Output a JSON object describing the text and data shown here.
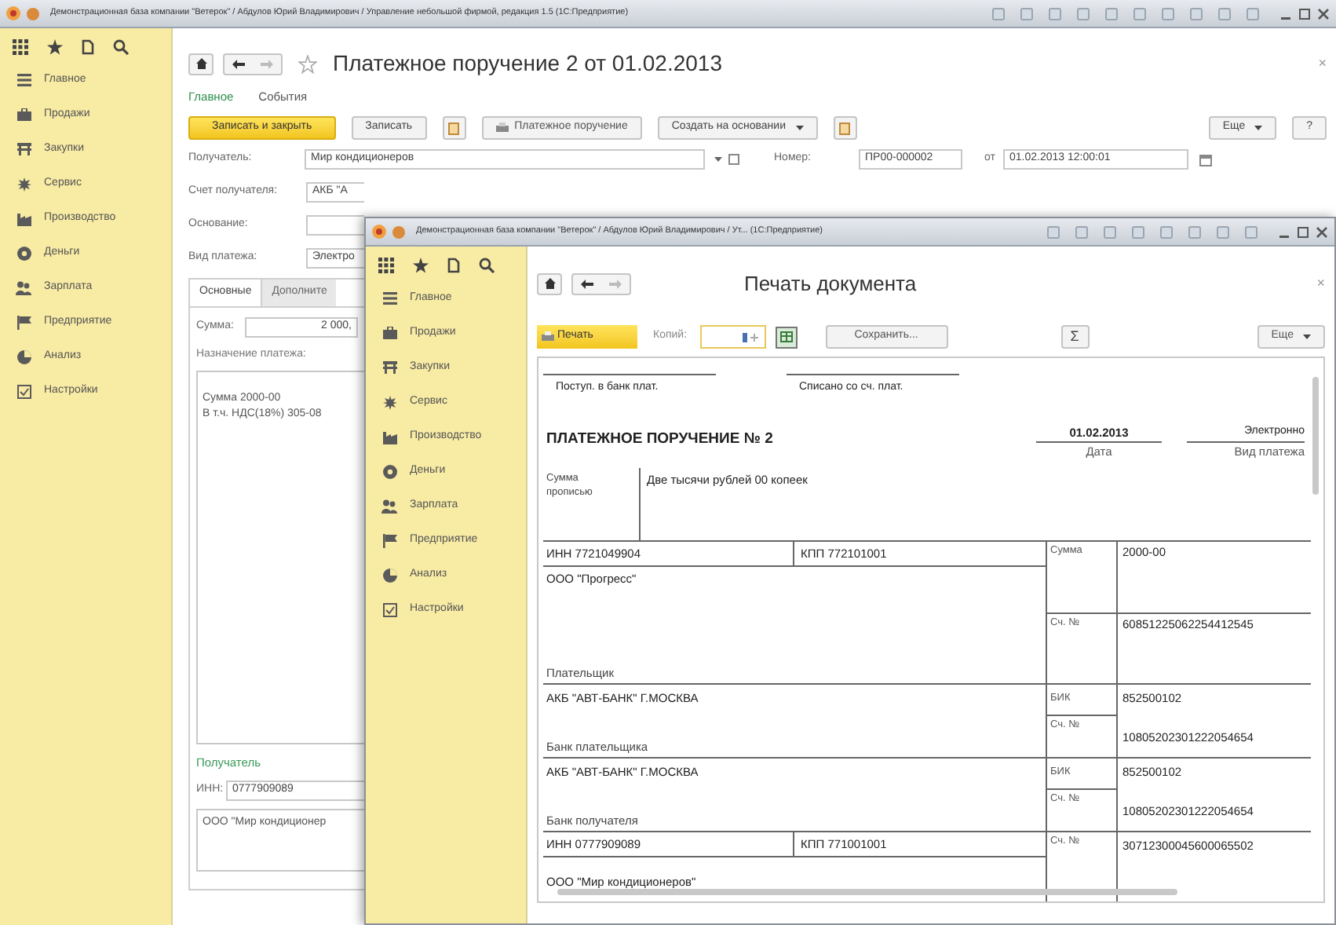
{
  "outer_window": {
    "title": "Демонстрационная база компании \"Ветерок\" / Абдулов Юрий Владимирович / Управление небольшой фирмой, редакция 1.5 (1С:Предприятие)"
  },
  "outer_sidebar": {
    "items": [
      {
        "label": "Главное",
        "kind": "menu"
      },
      {
        "label": "Продажи",
        "kind": "briefcase"
      },
      {
        "label": "Закупки",
        "kind": "shelf"
      },
      {
        "label": "Сервис",
        "kind": "gear"
      },
      {
        "label": "Производство",
        "kind": "factory"
      },
      {
        "label": "Деньги",
        "kind": "coin"
      },
      {
        "label": "Зарплата",
        "kind": "people"
      },
      {
        "label": "Предприятие",
        "kind": "flag"
      },
      {
        "label": "Анализ",
        "kind": "pie"
      },
      {
        "label": "Настройки",
        "kind": "panel"
      }
    ]
  },
  "outer_form": {
    "title": "Платежное поручение 2 от 01.02.2013",
    "close": "×",
    "tabs": [
      {
        "label": "Главное",
        "selected": true
      },
      {
        "label": "События",
        "selected": false
      }
    ],
    "toolbar": [
      {
        "kind": "primary",
        "label": "Записать и закрыть"
      },
      {
        "kind": "plain",
        "label": "Записать"
      },
      {
        "kind": "icon"
      },
      {
        "kind": "print",
        "label": "Платежное поручение"
      },
      {
        "kind": "dropdown",
        "label": "Создать на основании"
      },
      {
        "kind": "icon"
      }
    ],
    "toolbar_right": [
      {
        "kind": "dropdown",
        "label": "Еще"
      },
      {
        "kind": "plain",
        "label": "?"
      }
    ],
    "recipient": {
      "label": "Получатель:",
      "value": "Мир кондиционеров"
    },
    "number": {
      "label": "Номер:",
      "value": "ПР00-000002"
    },
    "date": {
      "label": "от",
      "value": "01.02.2013 12:00:01"
    },
    "fields": [
      {
        "label": "Счет получателя:",
        "value": "АКБ \"А"
      },
      {
        "label": "Основание:"
      },
      {
        "label": "Вид платежа:",
        "value": "Электро"
      }
    ],
    "inner_tabs": [
      {
        "label": "Основные",
        "selected": true
      },
      {
        "label": "Дополните",
        "selected": false
      }
    ],
    "amount": {
      "label": "Сумма:",
      "value": "2 000,"
    },
    "purpose": {
      "label": "Назначение платежа:",
      "lines": [
        "Сумма 2000-00",
        "В т.ч. НДС(18%) 305-08"
      ]
    },
    "recipient_section": "Получатель",
    "inn": {
      "label": "ИНН:",
      "value": "0777909089"
    },
    "recipient_name": "ООО \"Мир кондиционер"
  },
  "print_window": {
    "title": "Демонстрационная база компании \"Ветерок\" / Абдулов Юрий Владимирович / Ут...  (1С:Предприятие)",
    "sidebar": {
      "items": [
        {
          "label": "Главное",
          "kind": "menu"
        },
        {
          "label": "Продажи",
          "kind": "briefcase"
        },
        {
          "label": "Закупки",
          "kind": "shelf"
        },
        {
          "label": "Сервис",
          "kind": "gear"
        },
        {
          "label": "Производство",
          "kind": "factory"
        },
        {
          "label": "Деньги",
          "kind": "coin"
        },
        {
          "label": "Зарплата",
          "kind": "people"
        },
        {
          "label": "Предприятие",
          "kind": "flag"
        },
        {
          "label": "Анализ",
          "kind": "pie"
        },
        {
          "label": "Настройки",
          "kind": "panel"
        }
      ]
    },
    "heading": "Печать документа",
    "close": "×",
    "print_button": "Печать",
    "copies_label": "Копий:",
    "save_button": "Сохранить...",
    "sum_button": "Σ",
    "more_button": "Еще"
  },
  "document": {
    "receipt_labels": [
      "Поступ. в банк плат.",
      "Списано со сч. плат."
    ],
    "title": "ПЛАТЕЖНОЕ ПОРУЧЕНИЕ № 2",
    "date": {
      "value": "01.02.2013",
      "caption": "Дата"
    },
    "payment_type": {
      "value": "Электронно",
      "caption": "Вид платежа"
    },
    "amount_words": {
      "label": "Сумма прописью",
      "value": "Две тысячи рублей 00 копеек"
    },
    "payer": {
      "inn": "ИНН 7721049904",
      "kpp": "КПП 772101001",
      "name": "ООО \"Прогресс\"",
      "caption": "Плательщик",
      "amount_label": "Сумма",
      "amount": "2000-00",
      "account_label": "Сч. №",
      "account": "60851225062254412545"
    },
    "payer_bank": {
      "name": "АКБ \"АВТ-БАНК\" Г.МОСКВА",
      "caption": "Банк плательщика",
      "bik_label": "БИК",
      "bik": "852500102",
      "account_label": "Сч. №",
      "account": "10805202301222054654"
    },
    "recipient_bank": {
      "name": "АКБ \"АВТ-БАНК\" Г.МОСКВА",
      "caption": "Банк получателя",
      "bik_label": "БИК",
      "bik": "852500102",
      "account_label": "Сч. №",
      "account": "10805202301222054654"
    },
    "recipient": {
      "inn": "ИНН 0777909089",
      "kpp": "КПП 771001001",
      "name": "ООО \"Мир кондиционеров\"",
      "account_label": "Сч. №",
      "account": "30712300045600065502"
    }
  }
}
